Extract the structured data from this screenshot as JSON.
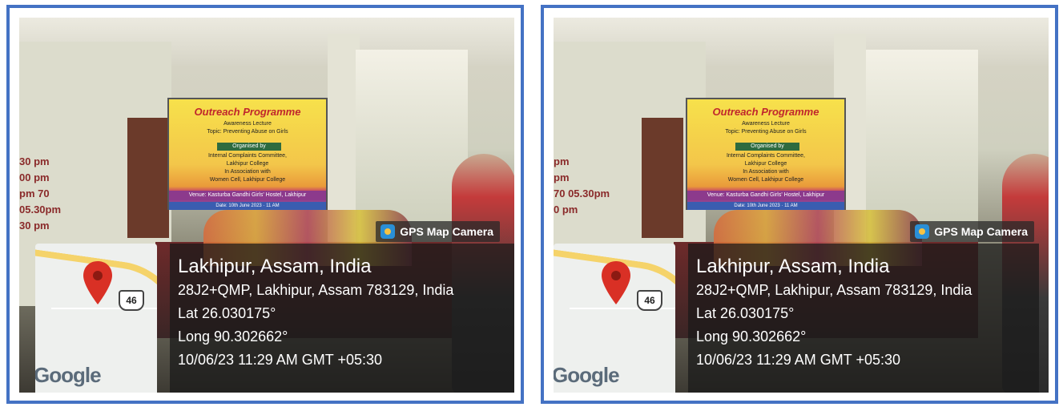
{
  "photos": [
    {
      "banner": {
        "title": "Outreach Programme",
        "line1": "Awareness Lecture",
        "line2": "Topic: Preventing Abuse on Girls",
        "organised": "Organised by",
        "line3": "Internal Complaints Committee,",
        "line4": "Lakhipur College",
        "line5": "In Association with",
        "line6": "Women Cell, Lakhipur College",
        "venue": "Venue: Kasturba Gandhi Girls' Hostel, Lakhipur",
        "date": "Date: 10th June 2023 · 11 AM"
      },
      "schedule": [
        "30 pm",
        "00 pm",
        "pm 70 05.30pm",
        "30 pm"
      ],
      "gps_badge": "GPS Map Camera",
      "map": {
        "shield_number": "46",
        "logo": "Google"
      },
      "location": {
        "place": "Lakhipur, Assam, India",
        "address": "28J2+QMP, Lakhipur, Assam 783129, India",
        "lat": "Lat 26.030175°",
        "long": "Long 90.302662°",
        "datetime": "10/06/23 11:29 AM GMT +05:30"
      }
    },
    {
      "banner": {
        "title": "Outreach Programme",
        "line1": "Awareness Lecture",
        "line2": "Topic: Preventing Abuse on Girls",
        "organised": "Organised by",
        "line3": "Internal Complaints Committee,",
        "line4": "Lakhipur College",
        "line5": "In Association with",
        "line6": "Women Cell, Lakhipur College",
        "venue": "Venue: Kasturba Gandhi Girls' Hostel, Lakhipur",
        "date": "Date: 10th June 2023 · 11 AM"
      },
      "schedule": [
        "pm",
        "pm",
        "70 05.30pm",
        "0 pm"
      ],
      "gps_badge": "GPS Map Camera",
      "map": {
        "shield_number": "46",
        "logo": "Google"
      },
      "location": {
        "place": "Lakhipur, Assam, India",
        "address": "28J2+QMP, Lakhipur, Assam 783129, India",
        "lat": "Lat 26.030175°",
        "long": "Long 90.302662°",
        "datetime": "10/06/23 11:29 AM GMT +05:30"
      }
    }
  ],
  "colors": {
    "frame_border": "#4472c4",
    "info_panel": "#191919",
    "pin": "#d93025"
  }
}
